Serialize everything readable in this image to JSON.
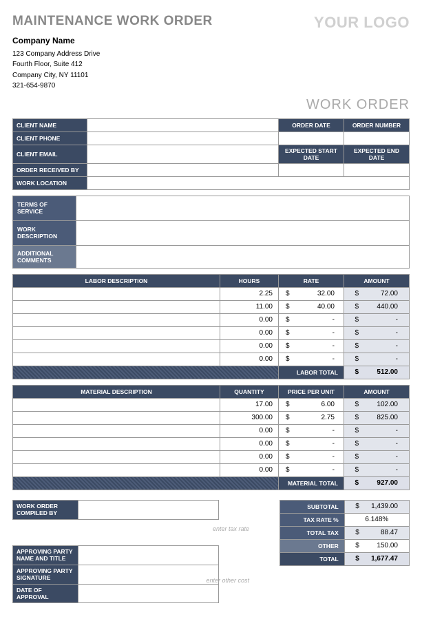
{
  "header": {
    "title": "MAINTENANCE WORK ORDER",
    "logo": "YOUR LOGO",
    "work_order_label": "WORK ORDER"
  },
  "company": {
    "name": "Company Name",
    "addr1": "123 Company Address Drive",
    "addr2": "Fourth Floor, Suite 412",
    "city": "Company City, NY 11101",
    "phone": "321-654-9870"
  },
  "client_fields": {
    "name_label": "CLIENT NAME",
    "phone_label": "CLIENT PHONE",
    "email_label": "CLIENT EMAIL",
    "received_label": "ORDER RECEIVED BY",
    "location_label": "WORK LOCATION",
    "order_date_label": "ORDER DATE",
    "order_num_label": "ORDER NUMBER",
    "start_date_label": "EXPECTED START DATE",
    "end_date_label": "EXPECTED END DATE"
  },
  "notes": {
    "terms_label": "TERMS OF SERVICE",
    "desc_label": "WORK DESCRIPTION",
    "comments_label": "ADDITIONAL COMMENTS"
  },
  "labor": {
    "headers": {
      "desc": "LABOR DESCRIPTION",
      "hours": "HOURS",
      "rate": "RATE",
      "amount": "AMOUNT"
    },
    "rows": [
      {
        "hours": "2.25",
        "rate": "32.00",
        "amount": "72.00"
      },
      {
        "hours": "11.00",
        "rate": "40.00",
        "amount": "440.00"
      },
      {
        "hours": "0.00",
        "rate": "-",
        "amount": "-"
      },
      {
        "hours": "0.00",
        "rate": "-",
        "amount": "-"
      },
      {
        "hours": "0.00",
        "rate": "-",
        "amount": "-"
      },
      {
        "hours": "0.00",
        "rate": "-",
        "amount": "-"
      }
    ],
    "total_label": "LABOR TOTAL",
    "total": "512.00"
  },
  "material": {
    "headers": {
      "desc": "MATERIAL DESCRIPTION",
      "qty": "QUANTITY",
      "ppu": "PRICE PER UNIT",
      "amount": "AMOUNT"
    },
    "rows": [
      {
        "qty": "17.00",
        "ppu": "6.00",
        "amount": "102.00"
      },
      {
        "qty": "300.00",
        "ppu": "2.75",
        "amount": "825.00"
      },
      {
        "qty": "0.00",
        "ppu": "-",
        "amount": "-"
      },
      {
        "qty": "0.00",
        "ppu": "-",
        "amount": "-"
      },
      {
        "qty": "0.00",
        "ppu": "-",
        "amount": "-"
      },
      {
        "qty": "0.00",
        "ppu": "-",
        "amount": "-"
      }
    ],
    "total_label": "MATERIAL TOTAL",
    "total": "927.00"
  },
  "totals": {
    "compiled_label": "WORK ORDER COMPILED BY",
    "approver_name_label": "APPROVING PARTY NAME AND TITLE",
    "approver_sig_label": "APPROVING PARTY SIGNATURE",
    "approval_date_label": "DATE OF APPROVAL",
    "tax_hint": "enter tax rate",
    "other_hint": "enter other cost",
    "subtotal_label": "SUBTOTAL",
    "subtotal": "1,439.00",
    "taxrate_label": "TAX RATE %",
    "taxrate": "6.148%",
    "totaltax_label": "TOTAL TAX",
    "totaltax": "88.47",
    "other_label": "OTHER",
    "other": "150.00",
    "total_label": "TOTAL",
    "total": "1,677.47"
  },
  "cur": "$"
}
